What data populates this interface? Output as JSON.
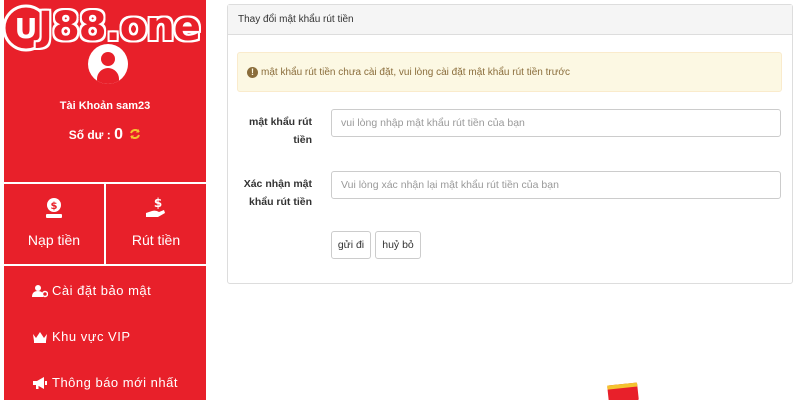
{
  "brand": {
    "logo_text": "J88.one",
    "badge_letter": "U",
    "accent_color": "#e8202a"
  },
  "account": {
    "name_label": "Tài Khoản sam23",
    "balance_label": "Số dư :",
    "balance_value": "0",
    "refresh_icon": "refresh-icon"
  },
  "quick_actions": [
    {
      "label": "Nạp tiền",
      "icon": "deposit-icon"
    },
    {
      "label": "Rút tiền",
      "icon": "withdraw-icon"
    }
  ],
  "menu": [
    {
      "label": "Cài đặt bảo mật",
      "icon": "user-settings-icon"
    },
    {
      "label": "Khu vực VIP",
      "icon": "vip-crown-icon"
    },
    {
      "label": "Thông báo mới nhất",
      "icon": "megaphone-icon"
    }
  ],
  "panel": {
    "title": "Thay đổi mật khẩu rút tiền",
    "alert_text": "mật khẩu rút tiền chưa cài đặt, vui lòng cài đặt mật khẩu rút tiền trước",
    "fields": [
      {
        "label_line1": "mật khẩu rút",
        "label_line2": "tiền",
        "placeholder": "vui lòng nhập mật khẩu rút tiền của bạn"
      },
      {
        "label_line1": "Xác nhận mật",
        "label_line2": "khẩu rút tiền",
        "placeholder": "Vui lòng xác nhận lại mật khẩu rút tiền của bạn"
      }
    ],
    "submit_label": "gửi đi",
    "cancel_label": "huỷ bỏ"
  }
}
